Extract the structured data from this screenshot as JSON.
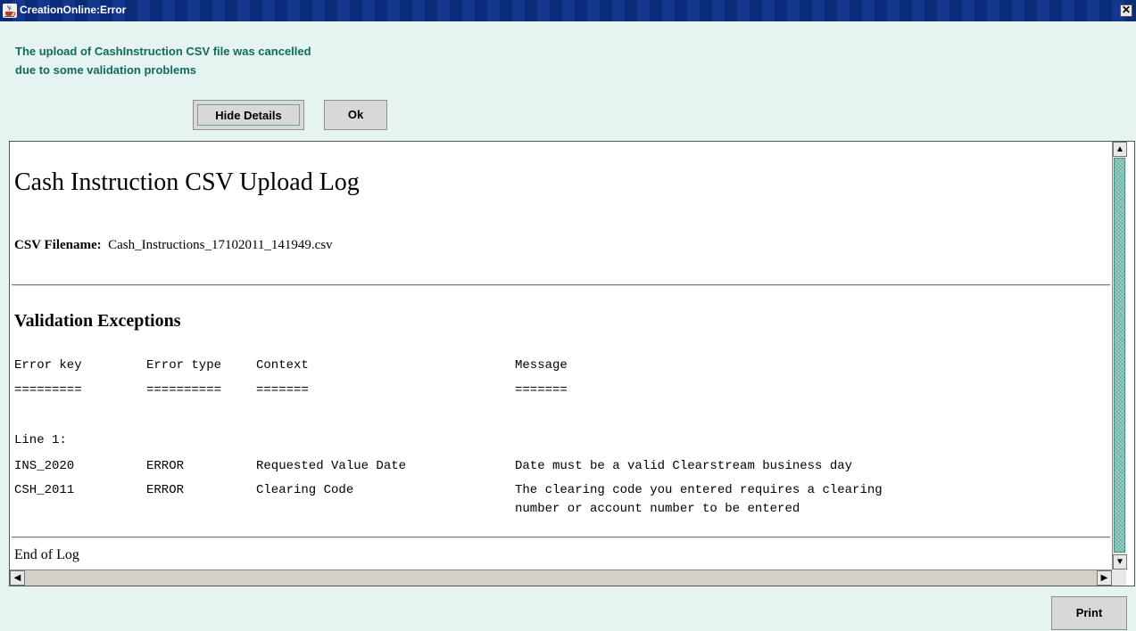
{
  "window": {
    "title": "CreationOnline:Error",
    "close_glyph": "✕"
  },
  "dialog": {
    "message_line1": "The upload of CashInstruction CSV file was cancelled",
    "message_line2": "due to some validation problems",
    "hide_details_label": "Hide Details",
    "ok_label": "Ok",
    "print_label": "Print"
  },
  "log": {
    "title": "Cash Instruction CSV Upload Log",
    "csv_filename_label": "CSV Filename:",
    "csv_filename": "Cash_Instructions_17102011_141949.csv",
    "section_title": "Validation Exceptions",
    "columns": {
      "key": "Error key",
      "type": "Error type",
      "context": "Context",
      "message": "Message"
    },
    "underlines": {
      "key": "=========",
      "type": "==========",
      "context": "=======",
      "message": "======="
    },
    "line_label": "Line 1:",
    "rows": [
      {
        "key": "INS_2020",
        "type": "ERROR",
        "context": "Requested Value Date",
        "message": "Date must be a valid Clearstream business day",
        "message2": ""
      },
      {
        "key": "CSH_2011",
        "type": "ERROR",
        "context": "Clearing Code",
        "message": "The clearing code you entered requires a clearing",
        "message2": "number or account number to be entered"
      }
    ],
    "end_text": "End of Log"
  },
  "icons": {
    "app": "java-coffee-cup-icon",
    "close": "close-icon",
    "up": "scroll-up-arrow-icon",
    "down": "scroll-down-arrow-icon",
    "left": "scroll-left-arrow-icon",
    "right": "scroll-right-arrow-icon"
  },
  "colors": {
    "title_bar": "#0b2c7e",
    "dialog_background": "#e5f3f1",
    "message_text": "#0f6b5c",
    "scroll_thumb": "#7fc3b6"
  }
}
